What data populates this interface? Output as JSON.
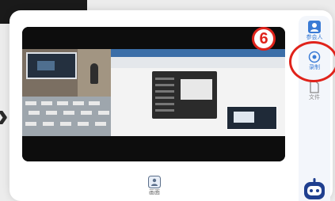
{
  "badge": {
    "number": "6"
  },
  "sidebar": {
    "items": [
      {
        "label": "参会人",
        "icon": "person-icon"
      },
      {
        "label": "录制",
        "icon": "record-icon"
      },
      {
        "label": "文件",
        "icon": "file-icon"
      }
    ]
  },
  "bottom": {
    "screen_label": "画面",
    "icon": "screen-icon"
  },
  "colors": {
    "accent": "#3a7bd5",
    "annotation": "#e0231b"
  }
}
